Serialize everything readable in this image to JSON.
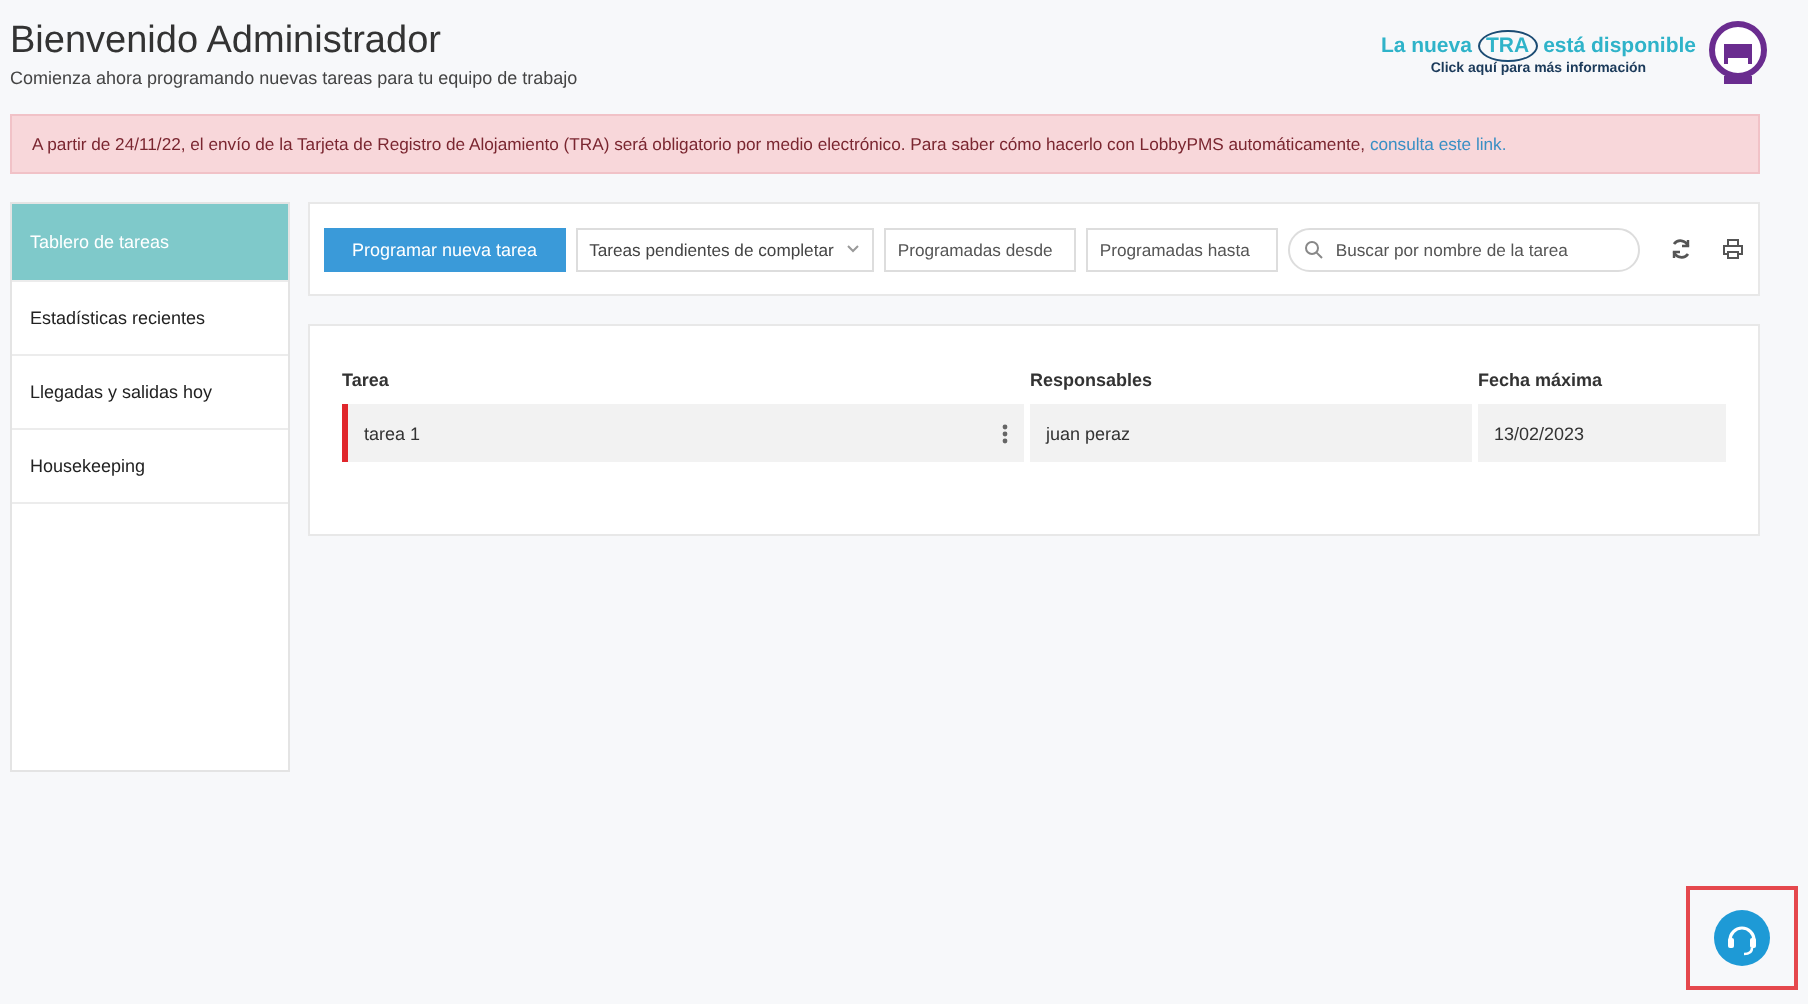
{
  "header": {
    "title": "Bienvenido Administrador",
    "subtitle": "Comienza ahora programando nuevas tareas para tu equipo de trabajo"
  },
  "promo": {
    "before": "La nueva",
    "highlight": "TRA",
    "after": "está disponible",
    "sub": "Click aquí para más información"
  },
  "alert": {
    "text": "A partir de 24/11/22, el envío de la Tarjeta de Registro de Alojamiento (TRA) será obligatorio por medio electrónico. Para saber cómo hacerlo con LobbyPMS automáticamente,",
    "link": "consulta este link."
  },
  "sidebar": {
    "items": [
      {
        "label": "Tablero de tareas",
        "selected": true
      },
      {
        "label": "Estadísticas recientes",
        "selected": false
      },
      {
        "label": "Llegadas y salidas hoy",
        "selected": false
      },
      {
        "label": "Housekeeping",
        "selected": false
      }
    ]
  },
  "toolbar": {
    "new_button": "Programar nueva tarea",
    "filter": "Tareas pendientes de completar",
    "from": {
      "placeholder": "Programadas desde"
    },
    "to": {
      "placeholder": "Programadas hasta"
    },
    "search": {
      "placeholder": "Buscar por nombre de la tarea"
    }
  },
  "table": {
    "columns": [
      "Tarea",
      "Responsables",
      "Fecha máxima"
    ],
    "rows": [
      {
        "task": "tarea 1",
        "responsible": "juan peraz",
        "due": "13/02/2023",
        "color": "#e0262b"
      }
    ]
  },
  "chat_button": {
    "highlighted": true
  }
}
